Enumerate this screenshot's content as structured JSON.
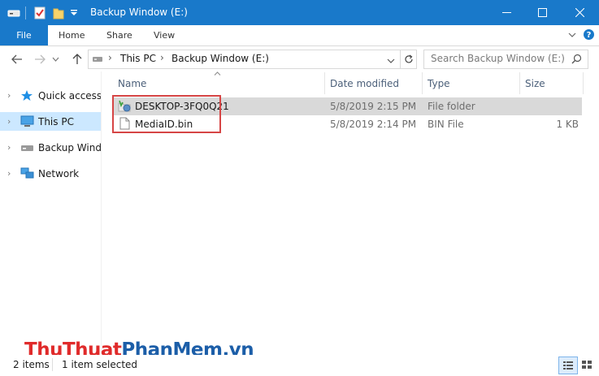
{
  "window": {
    "title": "Backup Window (E:)"
  },
  "ribbon": {
    "tabs": [
      {
        "label": "File",
        "active": true
      },
      {
        "label": "Home"
      },
      {
        "label": "Share"
      },
      {
        "label": "View"
      }
    ]
  },
  "address": {
    "breadcrumb": [
      "This PC",
      "Backup Window (E:)"
    ]
  },
  "search": {
    "placeholder": "Search Backup Window (E:)"
  },
  "nav": {
    "items": [
      {
        "label": "Quick access",
        "icon": "star-icon"
      },
      {
        "label": "This PC",
        "icon": "computer-icon",
        "selected": true
      },
      {
        "label": "Backup Windo",
        "icon": "drive-icon"
      },
      {
        "label": "Network",
        "icon": "network-icon"
      }
    ]
  },
  "columns": {
    "name": "Name",
    "date": "Date modified",
    "type": "Type",
    "size": "Size"
  },
  "files": [
    {
      "name": "DESKTOP-3FQ0Q21",
      "date": "5/8/2019 2:15 PM",
      "type": "File folder",
      "size": "",
      "icon": "backup-folder-icon",
      "selected": true
    },
    {
      "name": "MediaID.bin",
      "date": "5/8/2019 2:14 PM",
      "type": "BIN File",
      "size": "1 KB",
      "icon": "file-icon",
      "selected": false
    }
  ],
  "status": {
    "items_count": "2 items",
    "selection": "1 item selected"
  },
  "watermark": {
    "part1": "Thu",
    "part2": "Thuat",
    "part3": "Phan",
    "part4": "Mem",
    "part5": ".vn"
  },
  "colors": {
    "titlebar": "#1979ca",
    "selection": "#cce8ff",
    "row_selected": "#d9d9d9",
    "highlight": "#d64545",
    "watermark_red": "#e02b2b",
    "watermark_blue": "#1c5ea8"
  }
}
